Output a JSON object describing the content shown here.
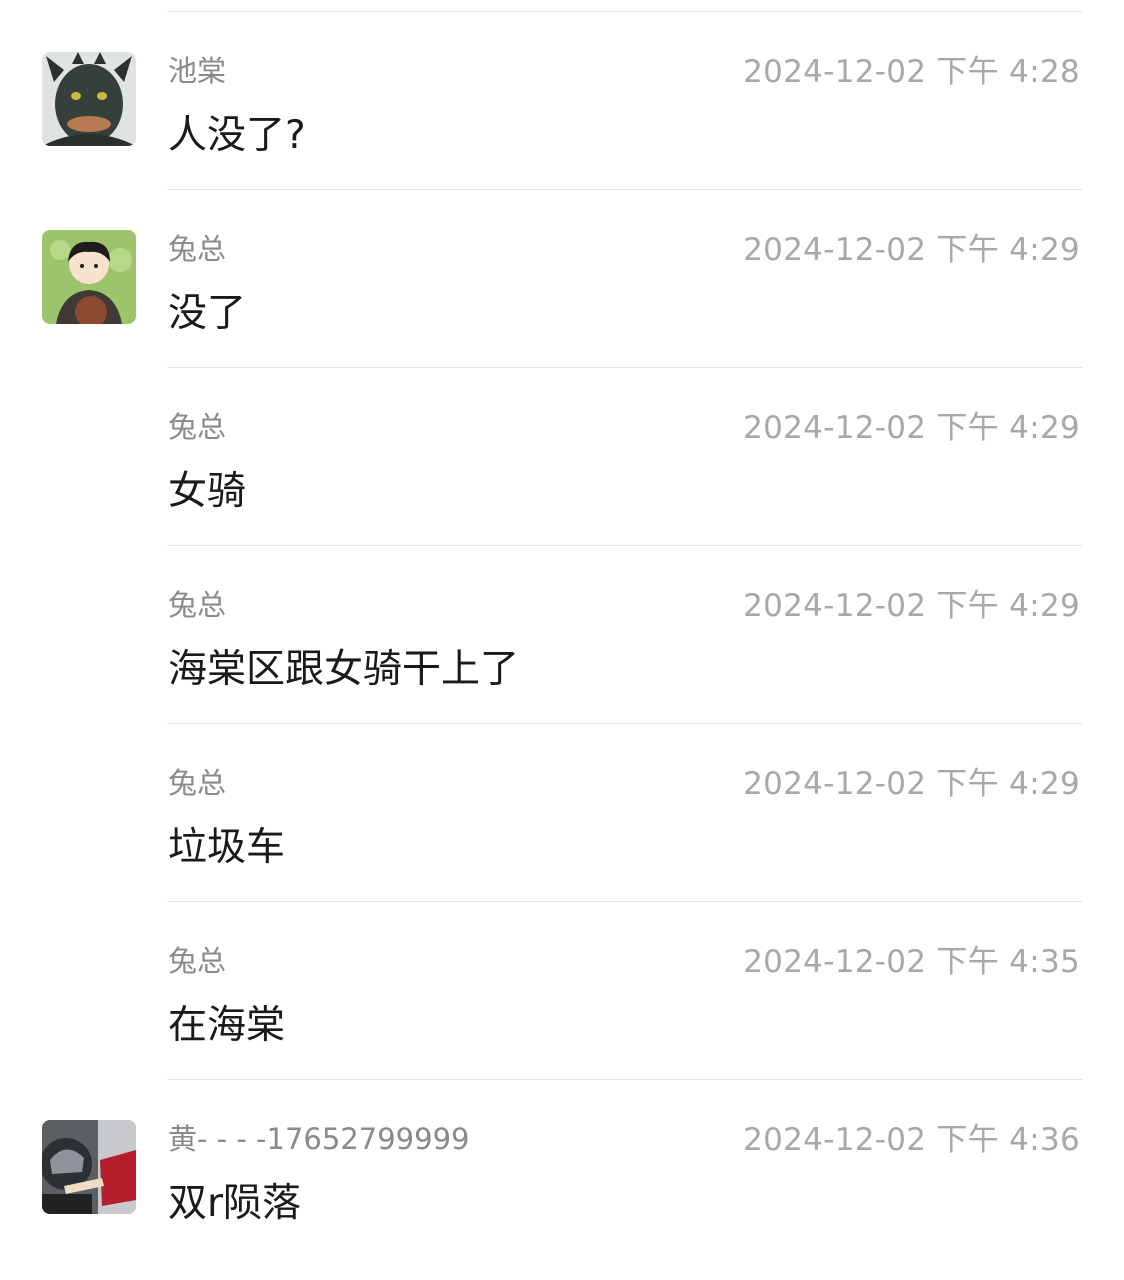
{
  "messages": [
    {
      "sender": "池棠",
      "time": "2024-12-02 下午 4:28",
      "text": "人没了?",
      "avatar": "dragon-monster-avatar"
    },
    {
      "sender": "兔总",
      "time": "2024-12-02 下午 4:29",
      "text": "没了",
      "avatar": "cartoon-boy-avatar"
    },
    {
      "sender": "兔总",
      "time": "2024-12-02 下午 4:29",
      "text": "女骑"
    },
    {
      "sender": "兔总",
      "time": "2024-12-02 下午 4:29",
      "text": "海棠区跟女骑干上了"
    },
    {
      "sender": "兔总",
      "time": "2024-12-02 下午 4:29",
      "text": "垃圾车"
    },
    {
      "sender": "兔总",
      "time": "2024-12-02 下午 4:35",
      "text": "在海棠"
    },
    {
      "sender": "黄- - - -17652799999",
      "time": "2024-12-02 下午 4:36",
      "text": "双r陨落",
      "avatar": "helmet-motorcycle-avatar"
    }
  ]
}
